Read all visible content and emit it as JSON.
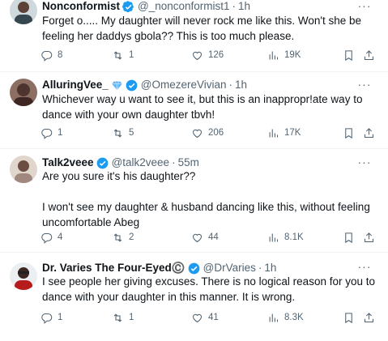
{
  "tweets": [
    {
      "name": "Nonconformist",
      "handle": "@_nonconformist1",
      "dot": "·",
      "time": "1h",
      "text": "Forget o..... My daughter will never rock me like this. Won't she be feeling her daddys gbola?? This is too much please.",
      "replies": "8",
      "retweets": "1",
      "likes": "126",
      "views": "19K",
      "badge": "verified-blue"
    },
    {
      "name": "AlluringVee_",
      "handle": "@OmezereVivian",
      "dot": "·",
      "time": "1h",
      "text": "Whichever way u want to see it, but this is an inappropr!ate way to dance with your own daughter tbvh!",
      "replies": "1",
      "retweets": "5",
      "likes": "206",
      "views": "17K",
      "badge": "diamond+verified-blue"
    },
    {
      "name": "Talk2veee",
      "handle": "@talk2veee",
      "dot": "·",
      "time": "55m",
      "text": "Are you sure it's his daughter??\n\nI won't see my daughter & husband  dancing like this, without feeling uncomfortable Abeg",
      "replies": "4",
      "retweets": "2",
      "likes": "44",
      "views": "8.1K",
      "badge": "verified-blue"
    },
    {
      "name": "Dr. Varies The Four-Eyed©️",
      "handle": "@DrVaries",
      "dot": "·",
      "time": "1h",
      "text": "I see people her giving excuses. There is no logical reason for you to dance with your daughter in this manner. It is wrong.",
      "replies": "1",
      "retweets": "1",
      "likes": "41",
      "views": "8.3K",
      "badge": "verified-blue"
    }
  ],
  "colors": {
    "text": "#0f1419",
    "muted": "#536471",
    "verified": "#1d9bf0",
    "divider": "#eff3f4"
  },
  "icons": [
    "reply-icon",
    "retweet-icon",
    "like-icon",
    "views-icon",
    "bookmark-icon",
    "share-icon",
    "more-icon",
    "verified-badge-icon",
    "diamond-icon"
  ]
}
